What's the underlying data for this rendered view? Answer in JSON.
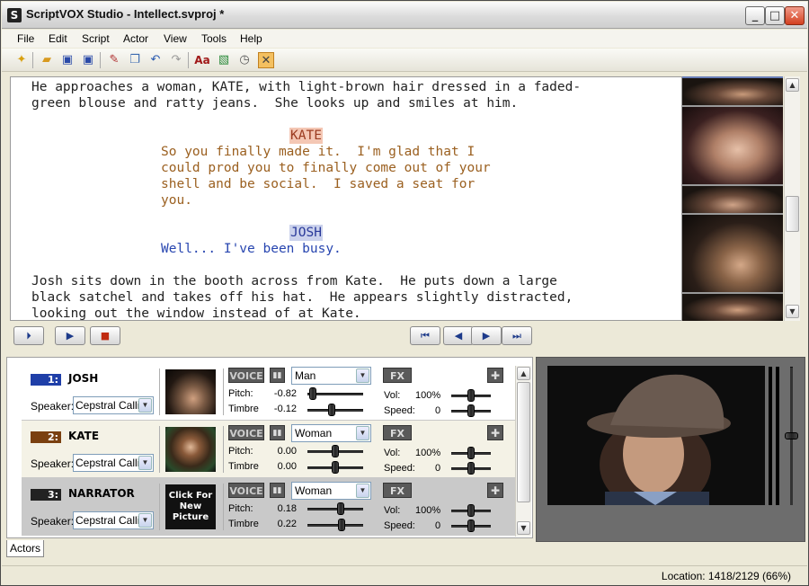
{
  "window": {
    "title": "ScriptVOX Studio - Intellect.svproj *",
    "app_icon": "S",
    "minimize": "_",
    "maximize": "□",
    "close": "✕"
  },
  "menu": [
    "File",
    "Edit",
    "Script",
    "Actor",
    "View",
    "Tools",
    "Help"
  ],
  "toolbar_icons": [
    "new-icon",
    "open-icon",
    "save-icon",
    "save-all-icon",
    "edit-icon",
    "copy-icon",
    "undo-icon",
    "redo-icon",
    "spell-check-icon",
    "picture-icon",
    "timer-icon",
    "tools-icon"
  ],
  "script": {
    "lines": [
      {
        "type": "action",
        "text": "He approaches a woman, KATE, with light-brown hair dressed in a faded-"
      },
      {
        "type": "action",
        "text": "green blouse and ratty jeans.  She looks up and smiles at him."
      },
      {
        "type": "kate-name",
        "text": "KATE"
      },
      {
        "type": "kate-dlg",
        "text": "So you finally made it.  I'm glad that I"
      },
      {
        "type": "kate-dlg",
        "text": "could prod you to finally come out of your"
      },
      {
        "type": "kate-dlg",
        "text": "shell and be social.  I saved a seat for"
      },
      {
        "type": "kate-dlg",
        "text": "you."
      },
      {
        "type": "josh-name",
        "text": "JOSH"
      },
      {
        "type": "josh-dlg",
        "text": "Well... I've been busy."
      },
      {
        "type": "action",
        "text": "Josh sits down in the booth across from Kate.  He puts down a large"
      },
      {
        "type": "action",
        "text": "black satchel and takes off his hat.  He appears slightly distracted,"
      },
      {
        "type": "action",
        "text": "looking out the window instead of at Kate."
      }
    ]
  },
  "transport": {
    "play_from": "⏵",
    "play": "▶",
    "stop": "■",
    "first": "⏮",
    "prev": "◀",
    "next": "▶",
    "last": "⏭"
  },
  "actors": [
    {
      "num": "1:",
      "name": "JOSH",
      "color": "#1f3fa8",
      "speaker_label": "Speaker:",
      "speaker": "Cepstral Callie",
      "voice_label": "VOICE",
      "voice": "Man",
      "fx_label": "FX",
      "pitch_label": "Pitch:",
      "pitch": "-0.82",
      "timbre_label": "Timbre",
      "timbre": "-0.12",
      "vol_label": "Vol:",
      "vol": "100%",
      "speed_label": "Speed:",
      "speed": "0",
      "pitch_level": 0.09,
      "timbre_level": 0.44,
      "vol_level": 0.5,
      "speed_level": 0.5,
      "bg": "#ffffff"
    },
    {
      "num": "2:",
      "name": "KATE",
      "color": "#7a4010",
      "speaker_label": "Speaker:",
      "speaker": "Cepstral Callie",
      "voice_label": "VOICE",
      "voice": "Woman",
      "fx_label": "FX",
      "pitch_label": "Pitch:",
      "pitch": "0.00",
      "timbre_label": "Timbre",
      "timbre": "0.00",
      "vol_label": "Vol:",
      "vol": "100%",
      "speed_label": "Speed:",
      "speed": "0",
      "pitch_level": 0.5,
      "timbre_level": 0.5,
      "vol_level": 0.5,
      "speed_level": 0.5,
      "bg": "#f4f2e6"
    },
    {
      "num": "3:",
      "name": "NARRATOR",
      "color": "#222222",
      "speaker_label": "Speaker:",
      "speaker": "Cepstral Callie",
      "voice_label": "VOICE",
      "voice": "Woman",
      "fx_label": "FX",
      "pitch_label": "Pitch:",
      "pitch": "0.18",
      "timbre_label": "Timbre",
      "timbre": "0.22",
      "vol_label": "Vol:",
      "vol": "100%",
      "speed_label": "Speed:",
      "speed": "0",
      "pitch_level": 0.59,
      "timbre_level": 0.61,
      "vol_level": 0.5,
      "speed_level": 0.5,
      "bg": "#c9c9c9",
      "picture_text": "Click For New Picture"
    }
  ],
  "actors_tab": "Actors",
  "status": {
    "location": "Location: 1418/2129 (66%)"
  }
}
